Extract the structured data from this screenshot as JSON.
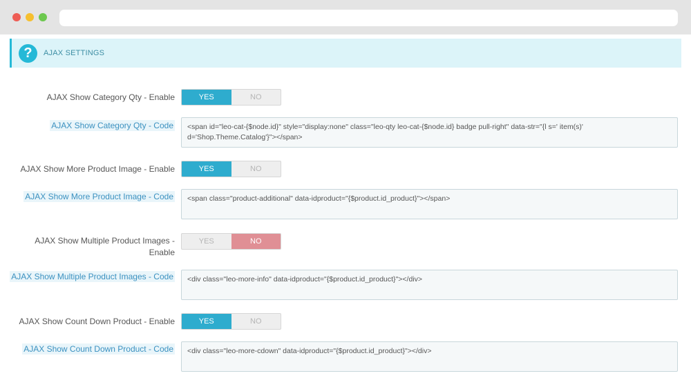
{
  "panel": {
    "title": "AJAX SETTINGS",
    "icon": "help-icon"
  },
  "settings": [
    {
      "enable_label": "AJAX Show Category Qty - Enable",
      "yes": "YES",
      "no": "NO",
      "value": "yes",
      "code_label": "AJAX Show Category Qty - Code",
      "code": "<span id=\"leo-cat-{$node.id}\" style=\"display:none\" class=\"leo-qty leo-cat-{$node.id} badge pull-right\" data-str=\"{l s=' item(s)' d='Shop.Theme.Catalog'}\"></span>"
    },
    {
      "enable_label": "AJAX Show More Product Image - Enable",
      "yes": "YES",
      "no": "NO",
      "value": "yes",
      "code_label": "AJAX Show More Product Image - Code",
      "code": "<span class=\"product-additional\" data-idproduct=\"{$product.id_product}\"></span>"
    },
    {
      "enable_label": "AJAX Show Multiple Product Images - Enable",
      "yes": "YES",
      "no": "NO",
      "value": "no",
      "code_label": "AJAX Show Multiple Product Images - Code",
      "code": "<div class=\"leo-more-info\" data-idproduct=\"{$product.id_product}\"></div>"
    },
    {
      "enable_label": "AJAX Show Count Down Product - Enable",
      "yes": "YES",
      "no": "NO",
      "value": "yes",
      "code_label": "AJAX Show Count Down Product - Code",
      "code": "<div class=\"leo-more-cdown\" data-idproduct=\"{$product.id_product}\"></div>"
    }
  ],
  "colors": {
    "accent": "#25b9d7",
    "yes_active": "#2eacce",
    "no_active": "#e08f95"
  }
}
